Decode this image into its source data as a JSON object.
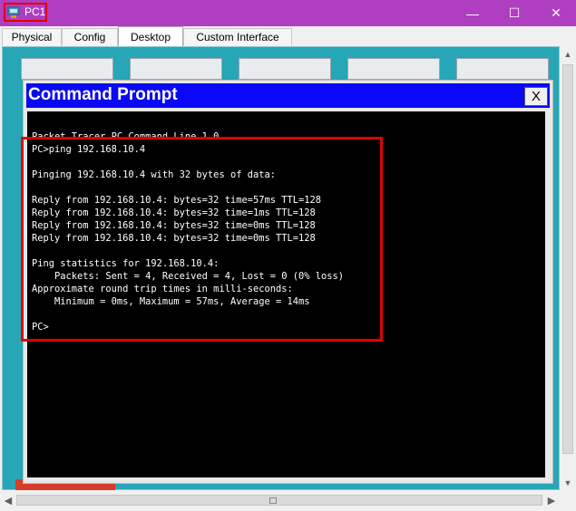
{
  "window": {
    "title": "PC1",
    "controls": {
      "minimize": "—",
      "maximize": "☐",
      "close": "✕"
    }
  },
  "tabs": [
    {
      "label": "Physical"
    },
    {
      "label": "Config"
    },
    {
      "label": "Desktop",
      "active": true
    },
    {
      "label": "Custom Interface"
    }
  ],
  "command_prompt": {
    "title": "Command Prompt",
    "close_label": "X",
    "lines": [
      "Packet Tracer PC Command Line 1.0",
      "PC>ping 192.168.10.4",
      "",
      "Pinging 192.168.10.4 with 32 bytes of data:",
      "",
      "Reply from 192.168.10.4: bytes=32 time=57ms TTL=128",
      "Reply from 192.168.10.4: bytes=32 time=1ms TTL=128",
      "Reply from 192.168.10.4: bytes=32 time=0ms TTL=128",
      "Reply from 192.168.10.4: bytes=32 time=0ms TTL=128",
      "",
      "Ping statistics for 192.168.10.4:",
      "    Packets: Sent = 4, Received = 4, Lost = 0 (0% loss)",
      "Approximate round trip times in milli-seconds:",
      "    Minimum = 0ms, Maximum = 57ms, Average = 14ms",
      "",
      "PC>"
    ]
  },
  "scrollbars": {
    "up_arrow": "▲",
    "down_arrow": "▼",
    "left_arrow": "◀",
    "right_arrow": "▶"
  },
  "colors": {
    "titlebar": "#b03ec0",
    "desktop_background": "#26a6b6",
    "command_header": "#0a08f5",
    "terminal_background": "#000000",
    "highlight": "#e00000"
  }
}
